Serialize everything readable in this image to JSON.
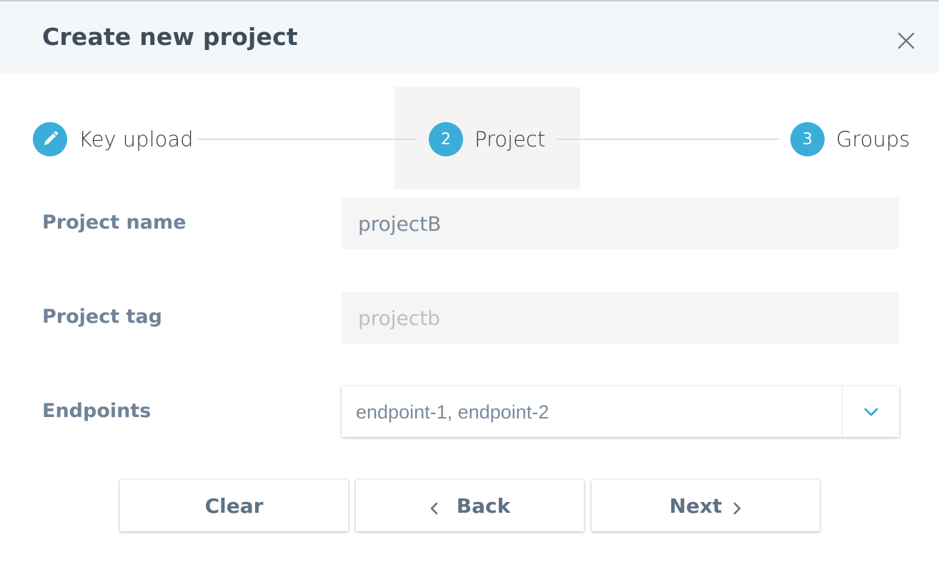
{
  "dialog": {
    "title": "Create new project",
    "close_icon": "close-icon"
  },
  "stepper": {
    "active_step": 2,
    "steps": [
      {
        "marker": "pencil-icon",
        "label": "Key upload",
        "state": "completed"
      },
      {
        "marker": "2",
        "label": "Project",
        "state": "active"
      },
      {
        "marker": "3",
        "label": "Groups",
        "state": "upcoming"
      }
    ]
  },
  "form": {
    "project_name": {
      "label": "Project name",
      "value": "projectB"
    },
    "project_tag": {
      "label": "Project tag",
      "value": "projectb",
      "disabled": true
    },
    "endpoints": {
      "label": "Endpoints",
      "value": "endpoint-1, endpoint-2",
      "icon": "chevron-down-icon"
    }
  },
  "actions": {
    "clear_label": "Clear",
    "back_label": "Back",
    "next_label": "Next"
  },
  "colors": {
    "accent": "#3aaed8",
    "header_bg": "#f4f7fa",
    "title_text": "#3f4c5a",
    "label_text": "#6f8398"
  }
}
